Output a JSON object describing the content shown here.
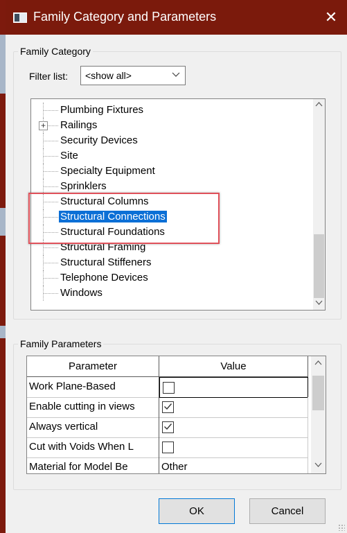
{
  "window": {
    "title": "Family Category and Parameters",
    "close_glyph": "✕"
  },
  "family_category": {
    "legend": "Family Category",
    "filter_label": "Filter list:",
    "filter_value": "<show all>",
    "items": [
      {
        "label": "Plumbing Fixtures",
        "expandable": false,
        "selected": false
      },
      {
        "label": "Railings",
        "expandable": true,
        "selected": false
      },
      {
        "label": "Security Devices",
        "expandable": false,
        "selected": false
      },
      {
        "label": "Site",
        "expandable": false,
        "selected": false
      },
      {
        "label": "Specialty Equipment",
        "expandable": false,
        "selected": false
      },
      {
        "label": "Sprinklers",
        "expandable": false,
        "selected": false
      },
      {
        "label": "Structural Columns",
        "expandable": false,
        "selected": false
      },
      {
        "label": "Structural Connections",
        "expandable": false,
        "selected": true
      },
      {
        "label": "Structural Foundations",
        "expandable": false,
        "selected": false
      },
      {
        "label": "Structural Framing",
        "expandable": false,
        "selected": false
      },
      {
        "label": "Structural Stiffeners",
        "expandable": false,
        "selected": false
      },
      {
        "label": "Telephone Devices",
        "expandable": false,
        "selected": false
      },
      {
        "label": "Windows",
        "expandable": false,
        "selected": false
      }
    ]
  },
  "family_parameters": {
    "legend": "Family Parameters",
    "columns": [
      "Parameter",
      "Value"
    ],
    "rows": [
      {
        "parameter": "Work Plane-Based",
        "type": "checkbox",
        "checked": false
      },
      {
        "parameter": "Enable cutting in views",
        "type": "checkbox",
        "checked": true
      },
      {
        "parameter": "Always vertical",
        "type": "checkbox",
        "checked": true
      },
      {
        "parameter": "Cut with Voids When L",
        "type": "checkbox",
        "checked": false
      },
      {
        "parameter": "Material for Model Be",
        "type": "text",
        "value": "Other"
      }
    ]
  },
  "buttons": {
    "ok": "OK",
    "cancel": "Cancel"
  },
  "colors": {
    "titlebar": "#7b1a0c",
    "selection": "#0b6fd6",
    "highlight_box": "#e0515a"
  }
}
